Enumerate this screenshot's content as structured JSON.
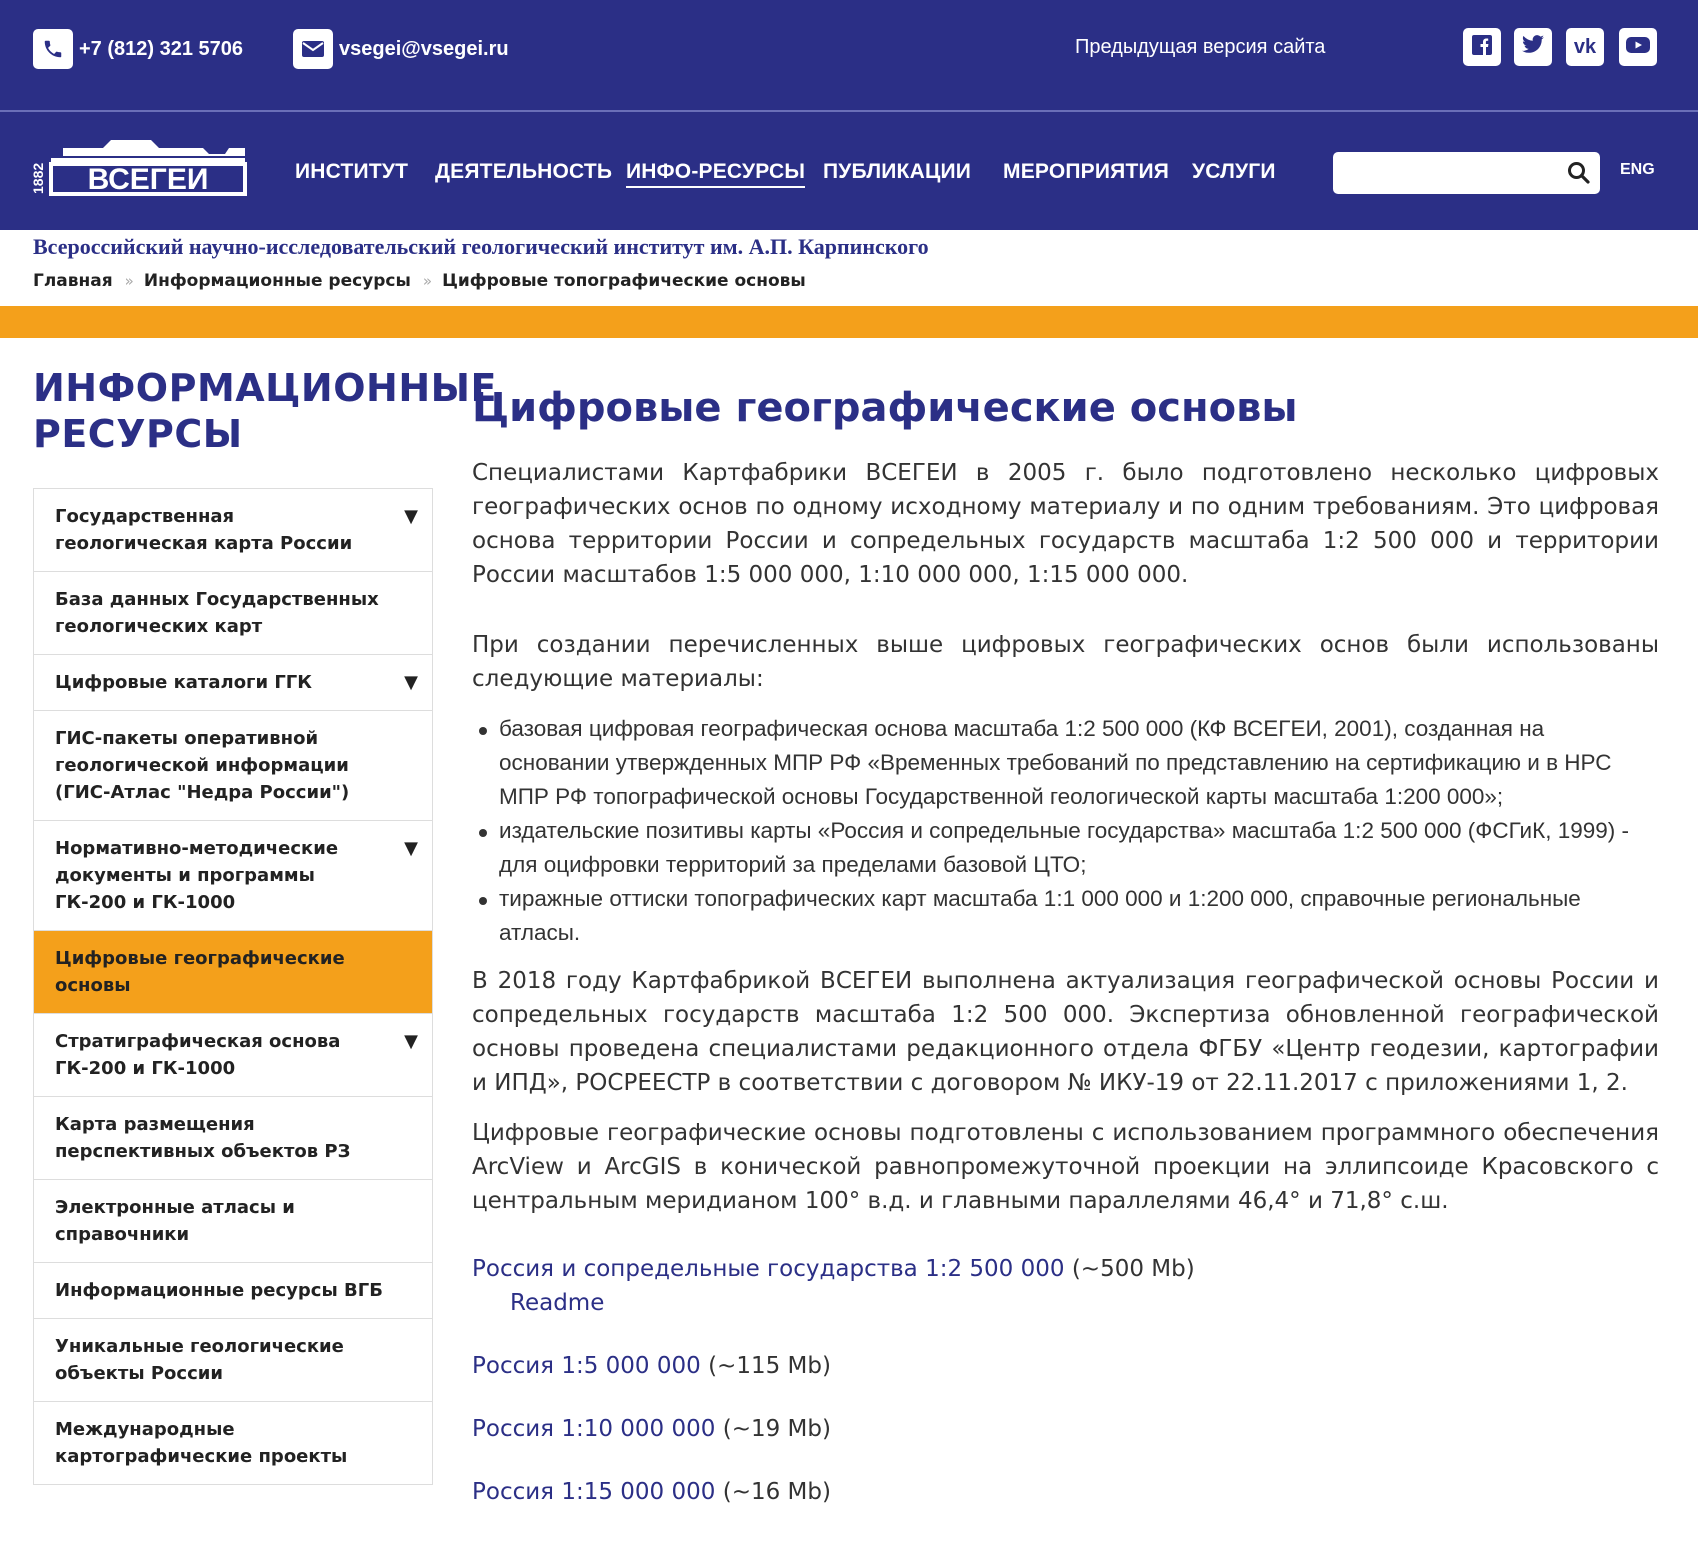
{
  "topbar": {
    "phone": "+7 (812) 321 5706",
    "email": "vsegei@vsegei.ru",
    "prev_version": "Предыдущая версия сайта",
    "social": [
      "facebook-icon",
      "twitter-icon",
      "vk-icon",
      "youtube-icon"
    ]
  },
  "logo": {
    "year": "1882",
    "name": "ВСЕГЕИ"
  },
  "nav": {
    "items": [
      "ИНСТИТУТ",
      "ДЕЯТЕЛЬНОСТЬ",
      "ИНФО-РЕСУРСЫ",
      "ПУБЛИКАЦИИ",
      "МЕРОПРИЯТИЯ",
      "УСЛУГИ"
    ],
    "active": "ИНФО-РЕСУРСЫ",
    "search_value": "",
    "lang": "ENG"
  },
  "institute_title": "Всероссийский научно-исследовательский геологический институт им. А.П. Карпинского",
  "breadcrumb": [
    "Главная",
    "Информационные ресурсы",
    "Цифровые топографические основы"
  ],
  "breadcrumb_sep": "»",
  "sidebar": {
    "title": "ИНФОРМАЦИОННЫЕ РЕСУРСЫ",
    "arrow": "▼",
    "items": [
      "Государственная геологическая карта России",
      "База данных Государственных геологических карт",
      "Цифровые каталоги ГГК",
      "ГИС-пакеты оперативной геологической информации (ГИС-Атлас \"Недра России\")",
      "Нормативно-методические документы и программы ГК-200 и ГК-1000",
      "Цифровые географические основы",
      "Стратиграфическая основа ГК-200 и ГК-1000",
      "Карта размещения перспективных объектов РЗ",
      "Электронные атласы и справочники",
      "Информационные ресурсы ВГБ",
      "Уникальные геологические объекты России",
      "Международные картографические проекты"
    ],
    "active_index": 5
  },
  "main": {
    "title": "Цифровые географические основы",
    "p1": "Специалистами Картфабрики ВСЕГЕИ в 2005 г. было подготовлено несколько цифровых географических основ по одному исходному материалу и по одним требованиям. Это цифровая основа территории России и сопредельных государств масштаба 1:2 500 000 и территории России масштабов 1:5 000 000, 1:10 000 000, 1:15 000 000.",
    "p2": "При создании перечисленных выше цифровых географических основ были использованы следующие материалы:",
    "bullets": [
      "базовая цифровая географическая основа масштаба 1:2 500 000 (КФ ВСЕГЕИ, 2001), созданная на основании утвержденных МПР РФ «Временных требований по представлению на сертификацию и в НРС МПР РФ топографической основы Государственной геологической карты масштаба 1:200 000»;",
      "издательские позитивы карты «Россия и сопредельные государства» масштаба 1:2 500 000 (ФСГиК, 1999) - для оцифровки территорий за пределами базовой ЦТО;",
      "тиражные оттиски топографических карт масштаба 1:1 000 000 и 1:200 000, справочные региональные атласы."
    ],
    "p3": "В 2018 году Картфабрикой ВСЕГЕИ выполнена актуализация географической основы России и сопредельных государств масштаба 1:2 500 000. Экспертиза обновленной географической основы проведена специалистами редакционного отдела ФГБУ «Центр геодезии, картографии и ИПД», РОСРЕЕСТР в соответствии с договором № ИКУ-19 от 22.11.2017 с приложениями 1, 2.",
    "p4": "Цифровые географические основы подготовлены с использованием программного обеспечения ArcView и ArcGIS в конической равнопромежуточной проекции на эллипсоиде Красовского с центральным меридианом 100° в.д. и главными параллелями 46,4° и 71,8° с.ш.",
    "downloads": [
      {
        "label": "Россия и сопредельные государства 1:2 500 000",
        "size": "(~500 Mb)"
      },
      {
        "label": "Россия 1:5 000 000",
        "size": "(~115 Mb)"
      },
      {
        "label": "Россия 1:10 000 000",
        "size": "(~19 Mb)"
      },
      {
        "label": "Россия 1:15 000 000",
        "size": "(~16 Mb)"
      }
    ],
    "readme": "Readme"
  },
  "colors": {
    "brand": "#2b2f86",
    "accent": "#f4a01b"
  }
}
